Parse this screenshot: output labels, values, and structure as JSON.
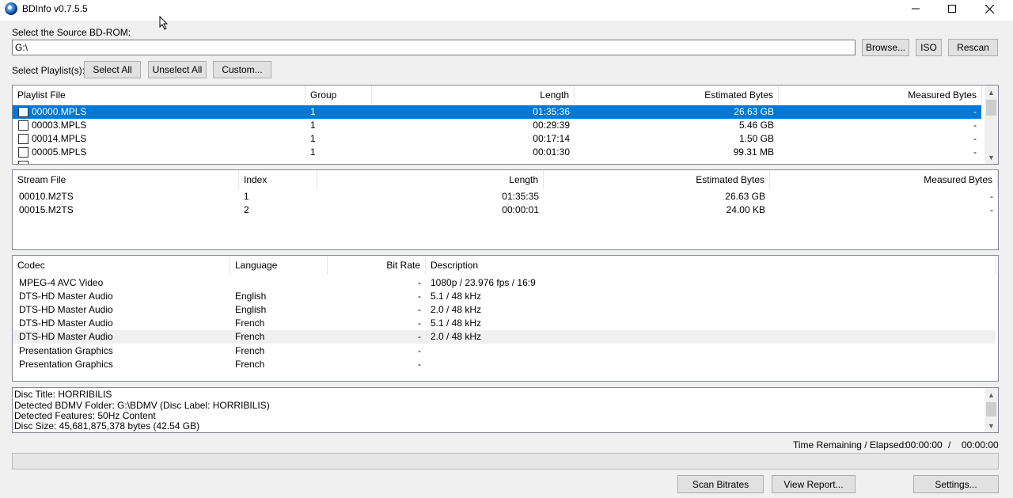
{
  "window": {
    "title": "BDInfo v0.7.5.5"
  },
  "source": {
    "label": "Select the Source BD-ROM:",
    "path": "G:\\",
    "browse": "Browse...",
    "iso": "ISO",
    "rescan": "Rescan"
  },
  "playlist_bar": {
    "label": "Select Playlist(s):",
    "select_all": "Select All",
    "unselect_all": "Unselect All",
    "custom": "Custom..."
  },
  "playlists": {
    "headers": [
      "Playlist File",
      "Group",
      "Length",
      "Estimated Bytes",
      "Measured Bytes"
    ],
    "rows": [
      {
        "file": "00000.MPLS",
        "group": "1",
        "length": "01:35:36",
        "est": "26.63 GB",
        "meas": "-"
      },
      {
        "file": "00003.MPLS",
        "group": "1",
        "length": "00:29:39",
        "est": "5.46 GB",
        "meas": "-"
      },
      {
        "file": "00014.MPLS",
        "group": "1",
        "length": "00:17:14",
        "est": "1.50 GB",
        "meas": "-"
      },
      {
        "file": "00005.MPLS",
        "group": "1",
        "length": "00:01:30",
        "est": "99.31 MB",
        "meas": "-"
      }
    ]
  },
  "streams": {
    "headers": [
      "Stream File",
      "Index",
      "Length",
      "Estimated Bytes",
      "Measured Bytes"
    ],
    "rows": [
      {
        "file": "00010.M2TS",
        "index": "1",
        "length": "01:35:35",
        "est": "26.63 GB",
        "meas": "-"
      },
      {
        "file": "00015.M2TS",
        "index": "2",
        "length": "00:00:01",
        "est": "24.00 KB",
        "meas": "-"
      }
    ]
  },
  "codecs": {
    "headers": [
      "Codec",
      "Language",
      "Bit Rate",
      "Description"
    ],
    "rows": [
      {
        "codec": "MPEG-4 AVC Video",
        "lang": "",
        "rate": "-",
        "desc": "1080p / 23.976 fps / 16:9"
      },
      {
        "codec": "DTS-HD Master Audio",
        "lang": "English",
        "rate": "-",
        "desc": "5.1 / 48 kHz"
      },
      {
        "codec": "DTS-HD Master Audio",
        "lang": "English",
        "rate": "-",
        "desc": "2.0 / 48 kHz"
      },
      {
        "codec": "DTS-HD Master Audio",
        "lang": "French",
        "rate": "-",
        "desc": "5.1 / 48 kHz"
      },
      {
        "codec": "DTS-HD Master Audio",
        "lang": "French",
        "rate": "-",
        "desc": "2.0 / 48 kHz"
      },
      {
        "codec": "Presentation Graphics",
        "lang": "French",
        "rate": "-",
        "desc": ""
      },
      {
        "codec": "Presentation Graphics",
        "lang": "French",
        "rate": "-",
        "desc": ""
      }
    ]
  },
  "disc_info": [
    "Disc Title: HORRIBILIS",
    "Detected BDMV Folder: G:\\BDMV (Disc Label: HORRIBILIS)",
    "Detected Features: 50Hz Content",
    "Disc Size: 45,681,875,378 bytes (42.54 GB)"
  ],
  "time": {
    "label": "Time Remaining / Elapsed:",
    "remaining": "00:00:00",
    "sep": "/",
    "elapsed": "00:00:00"
  },
  "progress": {
    "value": 0
  },
  "bottom": {
    "scan": "Scan Bitrates",
    "report": "View Report...",
    "settings": "Settings..."
  },
  "colors": {
    "selection": "#0078d7",
    "window_bg": "#f0f0f0"
  }
}
